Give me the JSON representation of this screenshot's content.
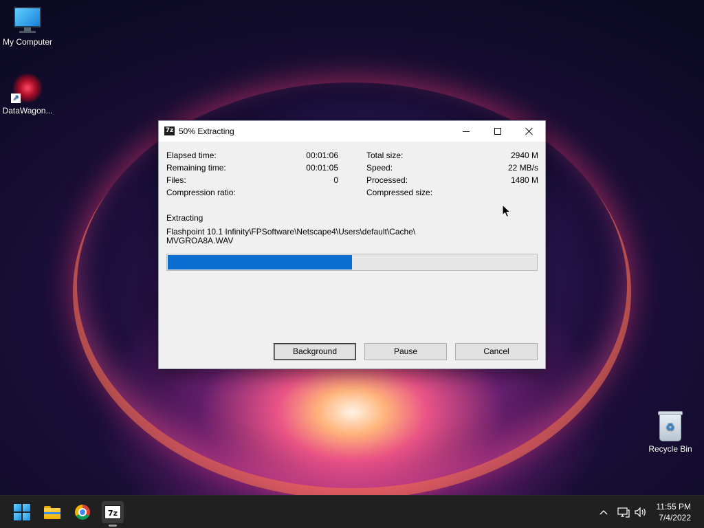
{
  "desktop": {
    "icons": [
      {
        "label": "My Computer"
      },
      {
        "label": "DataWagon..."
      },
      {
        "label": "Recycle Bin"
      }
    ]
  },
  "dialog": {
    "title": "50% Extracting",
    "app_icon_text": "7z",
    "stats_left": [
      {
        "label": "Elapsed time:",
        "value": "00:01:06"
      },
      {
        "label": "Remaining time:",
        "value": "00:01:05"
      },
      {
        "label": "Files:",
        "value": "0"
      },
      {
        "label": "Compression ratio:",
        "value": ""
      }
    ],
    "stats_right": [
      {
        "label": "Total size:",
        "value": "2940 M"
      },
      {
        "label": "Speed:",
        "value": "22 MB/s"
      },
      {
        "label": "Processed:",
        "value": "1480 M"
      },
      {
        "label": "Compressed size:",
        "value": ""
      }
    ],
    "status": "Extracting",
    "path_line1": "Flashpoint 10.1 Infinity\\FPSoftware\\Netscape4\\Users\\default\\Cache\\",
    "path_line2": "MVGROA8A.WAV",
    "progress_fraction": 0.5,
    "progress_color": "#0a6fd0",
    "buttons": {
      "background": "Background",
      "pause": "Pause",
      "cancel": "Cancel"
    }
  },
  "taskbar": {
    "apps": [
      {
        "name": "start-icon"
      },
      {
        "name": "file-explorer-icon"
      },
      {
        "name": "chrome-icon"
      },
      {
        "name": "7zip-icon",
        "text": "7z"
      }
    ],
    "clock": {
      "time": "11:55 PM",
      "date": "7/4/2022"
    }
  }
}
